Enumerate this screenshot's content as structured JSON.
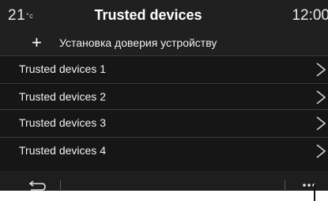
{
  "header": {
    "temperature": "21",
    "temperature_unit": "°c",
    "title": "Trusted devices",
    "time": "12:00"
  },
  "add_device": {
    "icon": "plus-icon",
    "label": "Установка доверия устройству"
  },
  "devices": [
    {
      "label": "Trusted devices 1",
      "icon": "chevron-right-icon"
    },
    {
      "label": "Trusted devices 2",
      "icon": "chevron-right-icon"
    },
    {
      "label": "Trusted devices 3",
      "icon": "chevron-right-icon"
    },
    {
      "label": "Trusted devices 4",
      "icon": "chevron-right-icon"
    }
  ],
  "footer": {
    "back_icon": "back-arrow-icon",
    "more_icon": "more-options-icon"
  },
  "colors": {
    "background": "#161616",
    "header": "#202020",
    "text": "#f2f2f2",
    "separator": "#3a3a3a"
  }
}
